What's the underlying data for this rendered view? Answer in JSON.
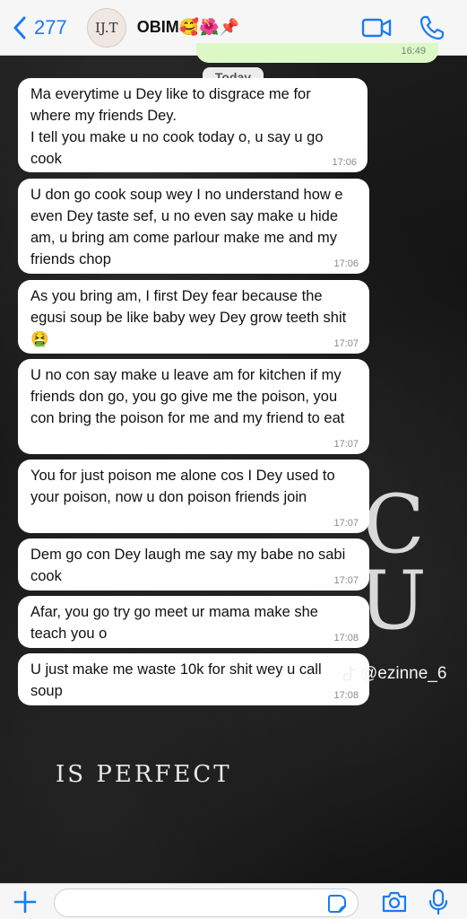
{
  "header": {
    "back_count": "277",
    "avatar_initials": "IJ.T",
    "contact_name": "OBIM🥰🌺📌"
  },
  "chat": {
    "prev_time": "16:49",
    "date_pill": "Today",
    "messages": [
      {
        "text": "Ma everytime u Dey like to disgrace me for where my friends Dey.\nI tell you make u no cook today o, u say u go cook",
        "time": "17:06"
      },
      {
        "text": "U don go cook soup wey I no understand how e even Dey taste sef, u no even say make u hide am, u bring am come parlour make me and my friends chop",
        "time": "17:06"
      },
      {
        "text": "As you bring am, I first Dey fear because the egusi soup be like baby wey Dey grow teeth shit 🤮",
        "time": "17:07"
      },
      {
        "text": "U no con say make u leave am for kitchen if my friends don go, you go give me the poison, you con bring the poison for me and my friend to eat",
        "time": "17:07"
      },
      {
        "text": "You for just poison me alone cos I Dey used to your poison, now u don poison friends join",
        "time": "17:07"
      },
      {
        "text": "Dem go con Dey laugh me say my babe no sabi cook",
        "time": "17:07"
      },
      {
        "text": "Afar, you go try go meet ur mama make she teach you o",
        "time": "17:08"
      },
      {
        "text": "U just make me waste 10k for shit wey u call soup",
        "time": "17:08"
      }
    ]
  },
  "wallpaper": {
    "caption": "IS PERFECT",
    "watermark": "@ezinne_6"
  },
  "composer": {
    "placeholder": ""
  },
  "colors": {
    "accent": "#1a7bf2",
    "bubble": "#ffffff",
    "sent_bubble": "#dcf8c6"
  }
}
